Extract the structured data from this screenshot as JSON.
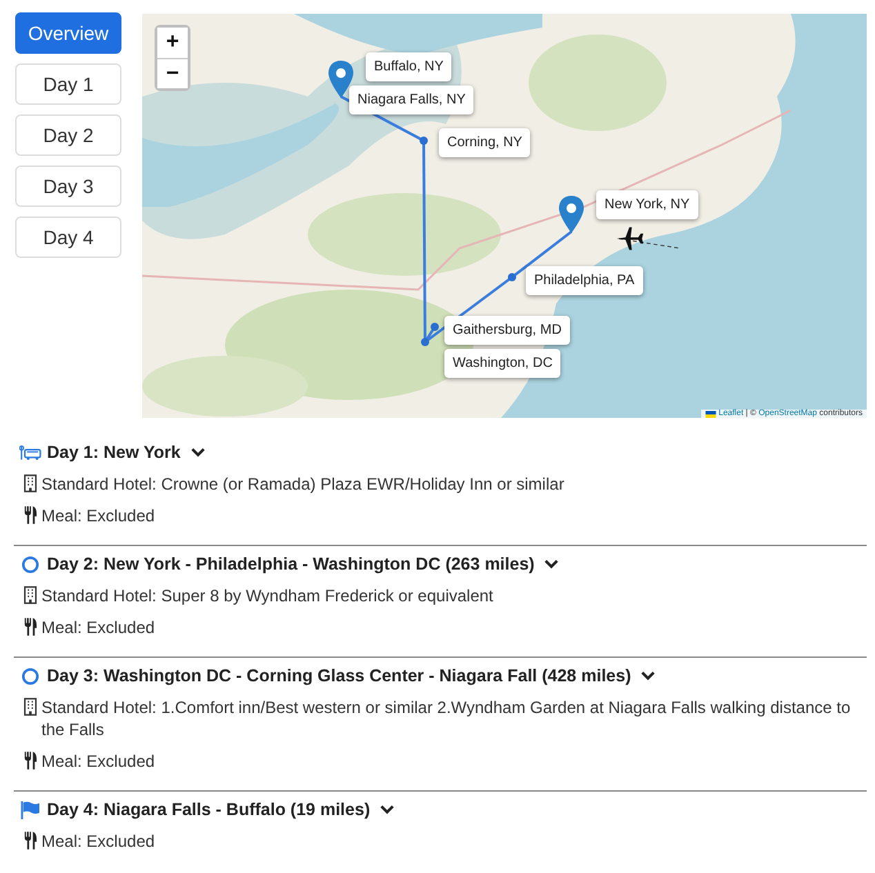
{
  "nav": [
    {
      "label": "Overview",
      "selected": true
    },
    {
      "label": "Day 1",
      "selected": false
    },
    {
      "label": "Day 2",
      "selected": false
    },
    {
      "label": "Day 3",
      "selected": false
    },
    {
      "label": "Day 4",
      "selected": false
    }
  ],
  "map": {
    "zoom_in": "+",
    "zoom_out": "−",
    "markers": [
      {
        "kind": "pin"
      },
      {
        "kind": "dot"
      },
      {
        "kind": "dot"
      },
      {
        "kind": "dot"
      },
      {
        "kind": "dot"
      },
      {
        "kind": "pin"
      }
    ],
    "labels": [
      {
        "text": "Buffalo, NY"
      },
      {
        "text": "Niagara Falls, NY"
      },
      {
        "text": "Corning, NY"
      },
      {
        "text": "New York, NY"
      },
      {
        "text": "Philadelphia, PA"
      },
      {
        "text": "Gaithersburg, MD"
      },
      {
        "text": "Washington, DC"
      }
    ],
    "attribution": {
      "link_1": "Leaflet",
      "separator": "| ©",
      "link_2": "OpenStreetMap",
      "tail": "contributors"
    }
  },
  "days": [
    {
      "kind": "bus",
      "title": "Day 1: New York",
      "details": [
        {
          "kind": "hotel",
          "text": "Standard Hotel: Crowne (or Ramada) Plaza EWR/Holiday Inn or similar"
        },
        {
          "kind": "meal",
          "text": "Meal: Excluded"
        }
      ]
    },
    {
      "kind": "circle",
      "title": "Day 2: New York - Philadelphia - Washington DC (263 miles)",
      "details": [
        {
          "kind": "hotel",
          "text": "Standard Hotel: Super 8 by Wyndham Frederick or equivalent"
        },
        {
          "kind": "meal",
          "text": "Meal: Excluded"
        }
      ]
    },
    {
      "kind": "circle",
      "title": "Day 3: Washington DC - Corning Glass Center - Niagara Fall (428 miles)",
      "details": [
        {
          "kind": "hotel",
          "text": "Standard Hotel: 1.Comfort inn/Best western or similar 2.Wyndham Garden at Niagara Falls walking distance to the Falls"
        },
        {
          "kind": "meal",
          "text": "Meal: Excluded"
        }
      ]
    },
    {
      "kind": "flag",
      "title": "Day 4: Niagara Falls - Buffalo (19 miles)",
      "details": [
        {
          "kind": "meal",
          "text": "Meal: Excluded"
        }
      ]
    }
  ]
}
